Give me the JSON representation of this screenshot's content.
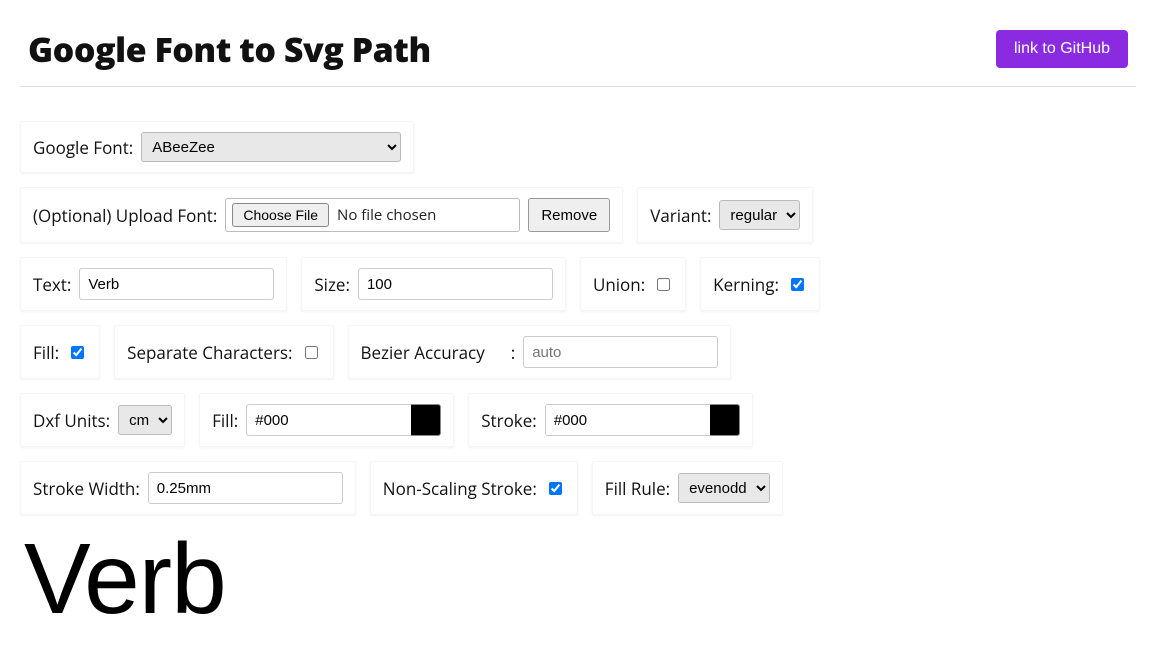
{
  "header": {
    "title": "Google Font to Svg Path",
    "github_label": "link to GitHub"
  },
  "font_row": {
    "label": "Google Font:",
    "selected": "ABeeZee"
  },
  "upload_row": {
    "label": "(Optional) Upload Font:",
    "choose_label": "Choose File",
    "status": "No file chosen",
    "remove_label": "Remove"
  },
  "variant": {
    "label": "Variant:",
    "selected": "regular"
  },
  "text": {
    "label": "Text:",
    "value": "Verb"
  },
  "size": {
    "label": "Size:",
    "value": "100"
  },
  "union": {
    "label": "Union:",
    "checked": false
  },
  "kerning": {
    "label": "Kerning:",
    "checked": true
  },
  "fill_cb": {
    "label": "Fill:",
    "checked": true
  },
  "separate": {
    "label": "Separate Characters:",
    "checked": false
  },
  "bezier": {
    "label": "Bezier Accuracy",
    "colon": ":",
    "placeholder": "auto",
    "value": ""
  },
  "dxf": {
    "label": "Dxf Units:",
    "selected": "cm"
  },
  "fill_color": {
    "label": "Fill:",
    "value": "#000"
  },
  "stroke_color": {
    "label": "Stroke:",
    "value": "#000"
  },
  "stroke_width": {
    "label": "Stroke Width:",
    "value": "0.25mm"
  },
  "nonscaling": {
    "label": "Non-Scaling Stroke:",
    "checked": true
  },
  "fill_rule": {
    "label": "Fill Rule:",
    "selected": "evenodd"
  },
  "preview_text": "Verb"
}
